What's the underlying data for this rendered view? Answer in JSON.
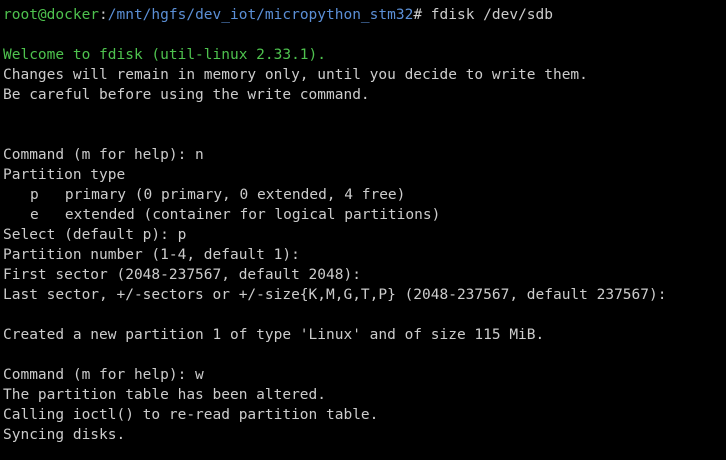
{
  "colors": {
    "background": "#000000",
    "text": "#cccccc",
    "prompt_user": "#4ec24e",
    "prompt_path": "#5b8fd6",
    "welcome": "#4ec24e"
  },
  "prompt": {
    "user_host": "root@docker",
    "separator": ":",
    "path": "/mnt/hgfs/dev_iot/micropython_stm32",
    "symbol": "#",
    "command": " fdisk /dev/sdb"
  },
  "output": {
    "welcome": "Welcome to fdisk (util-linux 2.33.1).",
    "changes_note": "Changes will remain in memory only, until you decide to write them.",
    "careful_note": "Be careful before using the write command.",
    "cmd1": "Command (m for help): n",
    "partition_type": "Partition type",
    "opt_p": "p   primary (0 primary, 0 extended, 4 free)",
    "opt_e": "e   extended (container for logical partitions)",
    "select": "Select (default p): p",
    "partition_number": "Partition number (1-4, default 1):",
    "first_sector": "First sector (2048-237567, default 2048):",
    "last_sector": "Last sector, +/-sectors or +/-size{K,M,G,T,P} (2048-237567, default 237567):",
    "created": "Created a new partition 1 of type 'Linux' and of size 115 MiB.",
    "cmd2": "Command (m for help): w",
    "altered": "The partition table has been altered.",
    "ioctl": "Calling ioctl() to re-read partition table.",
    "syncing": "Syncing disks."
  }
}
